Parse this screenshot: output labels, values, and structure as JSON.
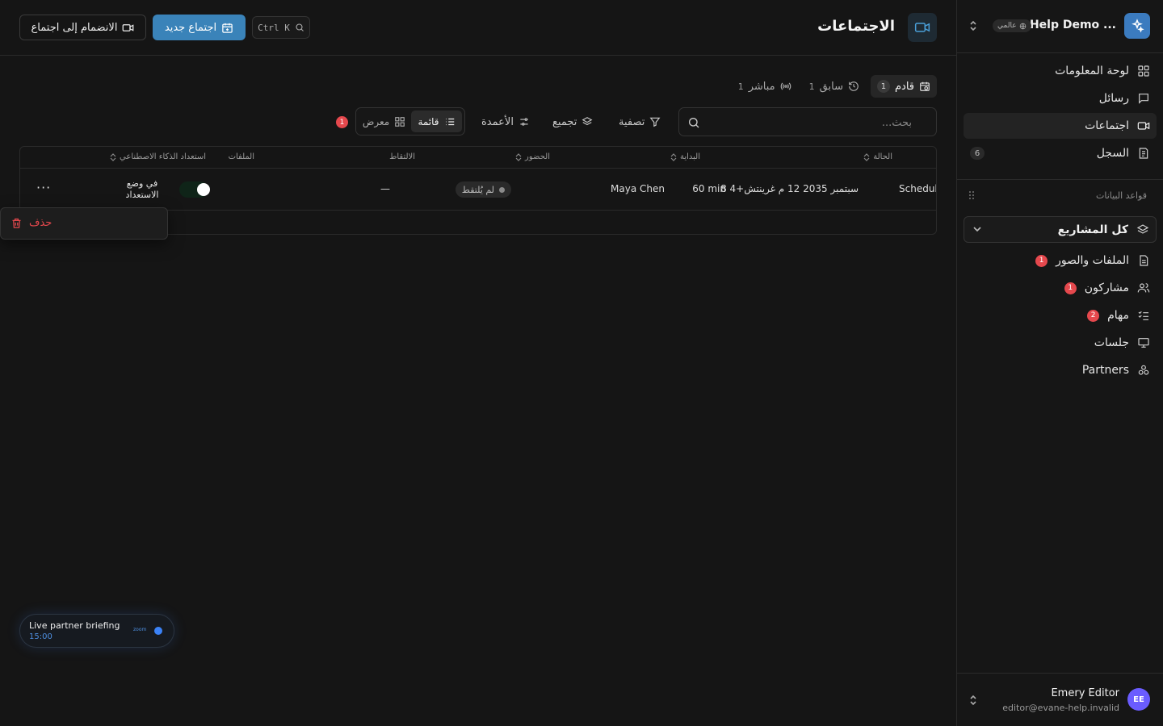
{
  "workspace": {
    "name": "Help Demo ...",
    "badge": "عالمي",
    "colors": {
      "logo_bg": "#3b7bbf"
    }
  },
  "sidebar": {
    "nav": [
      {
        "label": "لوحة المعلومات",
        "icon": "dashboard-icon"
      },
      {
        "label": "رسائل",
        "icon": "message-icon"
      },
      {
        "label": "اجتماعات",
        "icon": "video-icon",
        "active": true
      },
      {
        "label": "السجل",
        "icon": "log-icon",
        "count": "6"
      }
    ],
    "databases_label": "قواعد البيانات",
    "project_select": "كل المشاريع",
    "sub_nav": [
      {
        "label": "الملفات والصور",
        "icon": "file-icon",
        "badge": "1"
      },
      {
        "label": "مشاركون",
        "icon": "users-icon",
        "badge": "1"
      },
      {
        "label": "مهام",
        "icon": "tasks-icon",
        "badge": "2"
      },
      {
        "label": "جلسات",
        "icon": "presentation-icon"
      },
      {
        "label": "Partners",
        "icon": "partners-icon"
      }
    ],
    "user": {
      "initials": "EE",
      "name": "Emery Editor",
      "email": "editor@evane-help.invalid"
    }
  },
  "header": {
    "title": "الاجتماعات",
    "shortcut": "Ctrl K",
    "new_meeting": "اجتماع جديد",
    "join_meeting": "الانضمام إلى اجتماع"
  },
  "tabs": [
    {
      "label": "قادم",
      "count": "1",
      "active": true,
      "icon": "calendar-icon"
    },
    {
      "label": "سابق",
      "count": "1",
      "icon": "history-icon"
    },
    {
      "label": "مباشر",
      "count": "1",
      "icon": "broadcast-icon"
    }
  ],
  "toolbar": {
    "search_placeholder": "بحث...",
    "filter": "تصفية",
    "group": "تجميع",
    "columns": "الأعمدة",
    "view_list": "قائمة",
    "view_gallery": "معرض",
    "filter_badge": "1"
  },
  "table": {
    "headers": {
      "status": "الحالة",
      "start": "البداية",
      "attendance": "الحضور",
      "capture": "الالتقاط",
      "files": "الملفات",
      "ai_readiness": "استعداد الذكاء الاصطناعي"
    },
    "rows": [
      {
        "status": "Schedul",
        "start_date": "8 سبتمبر 2035 12 م غرينتش+4",
        "duration": "60 min",
        "attendance": "Maya Chen",
        "capture": "لم يُلتقط",
        "files": "—",
        "ai_state": "في وضع الاستعداد",
        "more": "···"
      }
    ]
  },
  "context_menu": {
    "delete": "حذف"
  },
  "live_widget": {
    "title": "Live partner briefing",
    "time": "15:00",
    "provider": "zoom"
  },
  "colors": {
    "accent": "#3a83b9",
    "danger": "#e5484d",
    "live": "#3b82f6"
  }
}
